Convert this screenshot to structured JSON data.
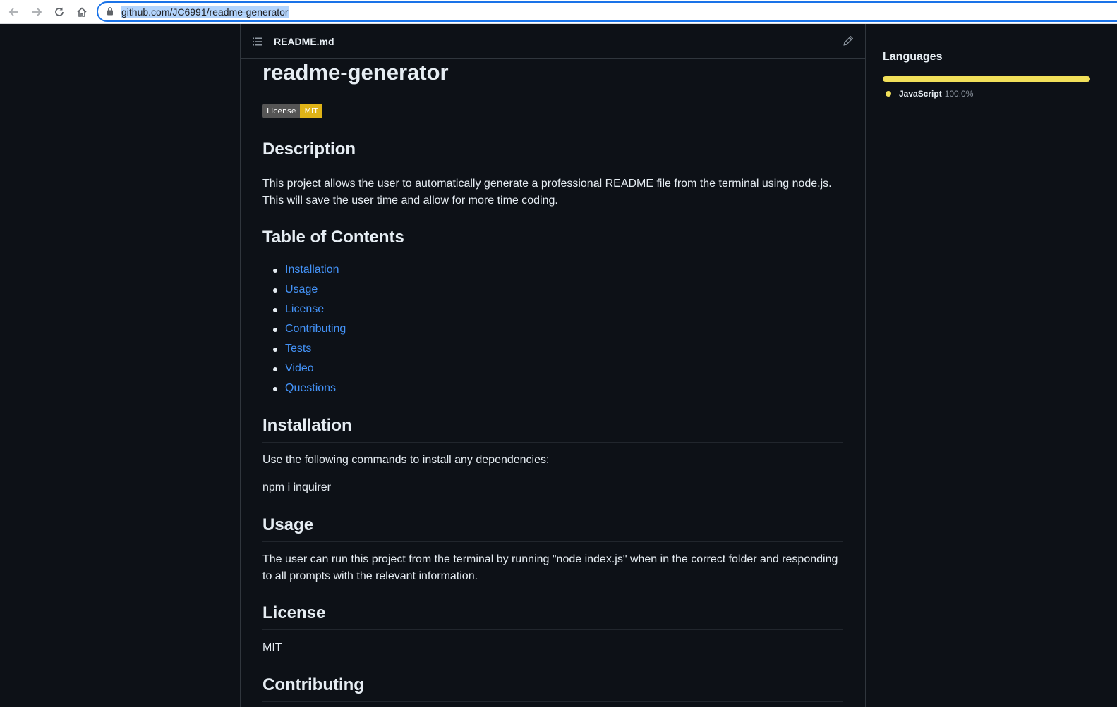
{
  "browser": {
    "url": "github.com/JC6991/readme-generator"
  },
  "readme_header": {
    "filename": "README.md"
  },
  "readme": {
    "title": "readme-generator",
    "badge": {
      "label": "License",
      "value": "MIT",
      "label_color": "#555555",
      "value_color": "#dfb317"
    },
    "description": {
      "heading": "Description",
      "text": "This project allows the user to automatically generate a professional README file from the terminal using node.js. This will save the user time and allow for more time coding."
    },
    "toc": {
      "heading": "Table of Contents",
      "items": [
        "Installation",
        "Usage",
        "License",
        "Contributing",
        "Tests",
        "Video",
        "Questions"
      ]
    },
    "installation": {
      "heading": "Installation",
      "text": "Use the following commands to install any dependencies:",
      "command": "npm i inquirer"
    },
    "usage": {
      "heading": "Usage",
      "text": "The user can run this project from the terminal by running \"node index.js\" when in the correct folder and responding to all prompts with the relevant information."
    },
    "license": {
      "heading": "License",
      "text": "MIT"
    },
    "contributing": {
      "heading": "Contributing"
    }
  },
  "sidebar": {
    "languages_title": "Languages",
    "languages": [
      {
        "name": "JavaScript",
        "percent": "100.0%",
        "share": 1.0,
        "color": "#f1e05a"
      }
    ]
  },
  "colors": {
    "background": "#0d1117",
    "text": "#e6edf3",
    "link": "#4493f8",
    "border": "#30363d",
    "url_highlight": "#b3d4fc",
    "omnibox_focus": "#1a73e8"
  },
  "icons": [
    "back-arrow-icon",
    "forward-arrow-icon",
    "reload-icon",
    "home-icon",
    "lock-icon",
    "list-icon",
    "pencil-icon"
  ]
}
